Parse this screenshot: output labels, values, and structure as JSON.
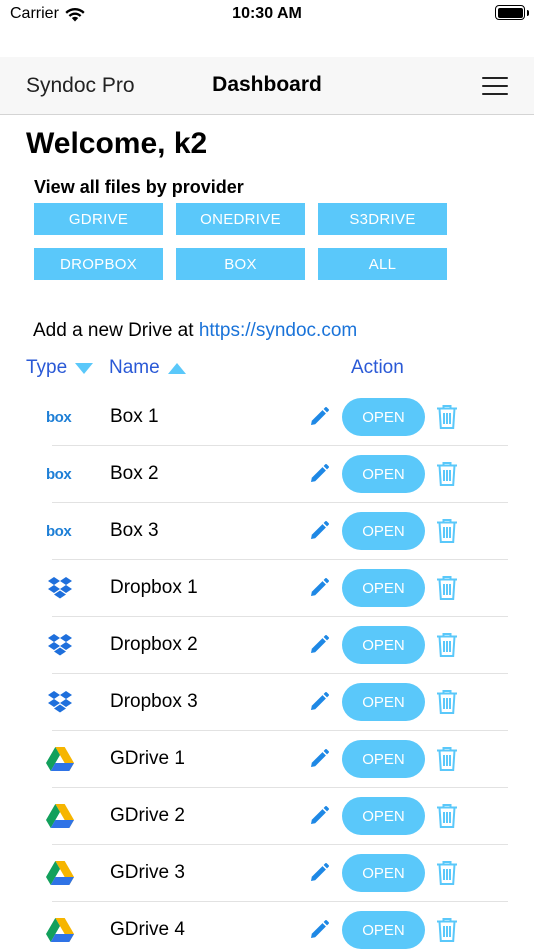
{
  "status": {
    "carrier": "Carrier",
    "time": "10:30 AM"
  },
  "nav": {
    "brand": "Syndoc Pro",
    "title": "Dashboard"
  },
  "welcome": "Welcome, k2",
  "providers": {
    "heading": "View all files by provider",
    "buttons": [
      "GDRIVE",
      "ONEDRIVE",
      "S3DRIVE",
      "DROPBOX",
      "BOX",
      "ALL"
    ]
  },
  "add_drive": {
    "text": "Add a new Drive at",
    "link": "https://syndoc.com"
  },
  "table": {
    "type_header": "Type",
    "name_header": "Name",
    "action_header": "Action"
  },
  "open_label": "OPEN",
  "colors": {
    "accent": "#5ac8fa",
    "header_blue": "#2a59d6",
    "link": "#1a73d9",
    "icon_blue": "#1e88e5"
  },
  "files": [
    {
      "type": "box",
      "icon": "box-logo-icon",
      "name": "Box 1"
    },
    {
      "type": "box",
      "icon": "box-logo-icon",
      "name": "Box 2"
    },
    {
      "type": "box",
      "icon": "box-logo-icon",
      "name": "Box 3"
    },
    {
      "type": "dropbox",
      "icon": "dropbox-logo-icon",
      "name": "Dropbox 1"
    },
    {
      "type": "dropbox",
      "icon": "dropbox-logo-icon",
      "name": "Dropbox 2"
    },
    {
      "type": "dropbox",
      "icon": "dropbox-logo-icon",
      "name": "Dropbox 3"
    },
    {
      "type": "gdrive",
      "icon": "gdrive-logo-icon",
      "name": "GDrive 1"
    },
    {
      "type": "gdrive",
      "icon": "gdrive-logo-icon",
      "name": "GDrive 2"
    },
    {
      "type": "gdrive",
      "icon": "gdrive-logo-icon",
      "name": "GDrive 3"
    },
    {
      "type": "gdrive",
      "icon": "gdrive-logo-icon",
      "name": "GDrive 4"
    }
  ]
}
